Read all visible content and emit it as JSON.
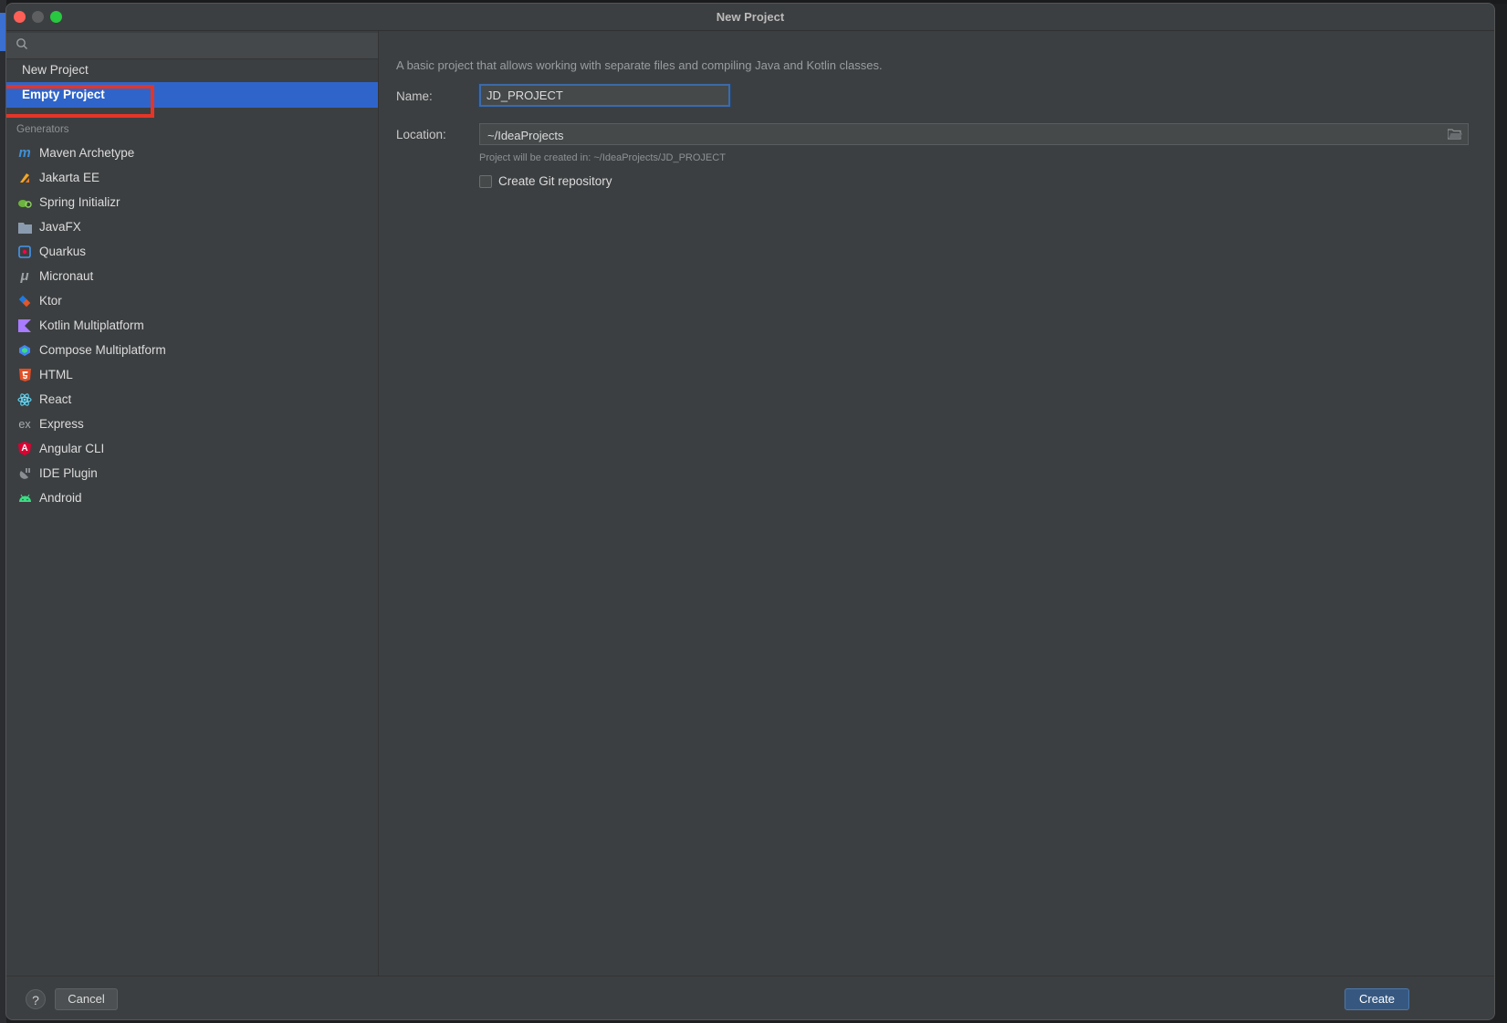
{
  "window": {
    "title": "New Project"
  },
  "sidebar": {
    "search_placeholder": "",
    "items": [
      {
        "label": "New Project",
        "selected": false
      },
      {
        "label": "Empty Project",
        "selected": true
      }
    ],
    "generators_label": "Generators",
    "generators": [
      {
        "label": "Maven Archetype",
        "icon": "maven-icon"
      },
      {
        "label": "Jakarta EE",
        "icon": "jakarta-ee-icon"
      },
      {
        "label": "Spring Initializr",
        "icon": "spring-icon"
      },
      {
        "label": "JavaFX",
        "icon": "javafx-icon"
      },
      {
        "label": "Quarkus",
        "icon": "quarkus-icon"
      },
      {
        "label": "Micronaut",
        "icon": "micronaut-icon"
      },
      {
        "label": "Ktor",
        "icon": "ktor-icon"
      },
      {
        "label": "Kotlin Multiplatform",
        "icon": "kotlin-icon"
      },
      {
        "label": "Compose Multiplatform",
        "icon": "compose-icon"
      },
      {
        "label": "HTML",
        "icon": "html5-icon"
      },
      {
        "label": "React",
        "icon": "react-icon"
      },
      {
        "label": "Express",
        "icon": "express-icon"
      },
      {
        "label": "Angular CLI",
        "icon": "angular-icon"
      },
      {
        "label": "IDE Plugin",
        "icon": "ide-plugin-icon"
      },
      {
        "label": "Android",
        "icon": "android-icon"
      }
    ],
    "icon_texts": {
      "maven": "m",
      "express": "ex",
      "angular": "A",
      "micronaut": "μ"
    }
  },
  "main": {
    "description": "A basic project that allows working with separate files and compiling Java and Kotlin classes.",
    "name_label": "Name:",
    "name_value": "JD_PROJECT",
    "location_label": "Location:",
    "location_value": "~/IdeaProjects",
    "location_hint": "Project will be created in: ~/IdeaProjects/JD_PROJECT",
    "git_label": "Create Git repository",
    "git_checked": false
  },
  "footer": {
    "help": "?",
    "cancel": "Cancel",
    "create": "Create"
  },
  "colors": {
    "selection": "#2f65ca",
    "highlight_box": "#e53527",
    "primary_button": "#365880",
    "panel_bg": "#3c3f41"
  }
}
